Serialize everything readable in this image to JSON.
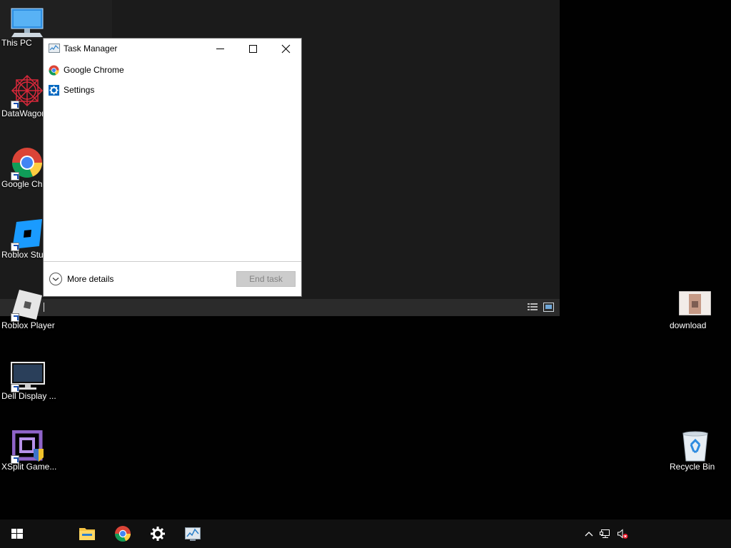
{
  "desktop": {
    "icons": [
      {
        "label": "This PC"
      },
      {
        "label": "DataWagon"
      },
      {
        "label": "Google Chr"
      },
      {
        "label": "Roblox Stu"
      },
      {
        "label": "Roblox Player"
      },
      {
        "label": "Dell Display ..."
      },
      {
        "label": "XSplit Game..."
      },
      {
        "label": "download"
      },
      {
        "label": "Recycle Bin"
      }
    ]
  },
  "task_manager": {
    "title": "Task Manager",
    "apps": [
      {
        "name": "Google Chrome",
        "icon": "chrome-icon"
      },
      {
        "name": "Settings",
        "icon": "settings-gear-icon"
      }
    ],
    "more_details": "More details",
    "end_task": "End task"
  },
  "taskbar": {
    "pinned": [
      "file-explorer-icon",
      "chrome-icon",
      "settings-icon",
      "task-manager-icon"
    ],
    "tray": [
      "show-hidden-icons-chevron",
      "network-icon",
      "volume-muted-icon"
    ]
  },
  "colors": {
    "desktop": "#010101",
    "background_window": "#1b1b1b",
    "taskbar": "#101010",
    "end_task_disabled": "#cccccc"
  }
}
